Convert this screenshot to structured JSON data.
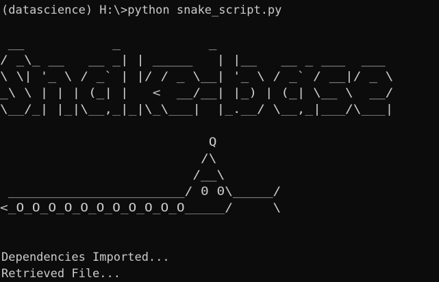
{
  "terminal": {
    "prompt": "(datascience) H:\\>python snake_script.py",
    "banner": [
      " __           _           _               ",
      "/ _\\_ __   __ _| | _____   | |__   __ _ ___  ___ ",
      "\\ \\| '_ \\ / _` | |/ / _ \\__| '_ \\ / _` / __|/ _ \\",
      "_\\ \\ | | | (_| |   <  __/__| |_) | (_| \\__ \\  __/",
      "\\__/_| |_|\\__,_|_|\\_\\___|  |_.__/ \\__,_|___/\\___|"
    ],
    "snake_art": [
      "                          Q",
      "                         /\\",
      "                        /__\\",
      " ______________________/ 0 0\\_____/",
      "<_O_O_O_O_O_O_O_O_O_O_O_____/     \\"
    ],
    "status": [
      "Dependencies Imported...",
      "Retrieved File..."
    ]
  }
}
